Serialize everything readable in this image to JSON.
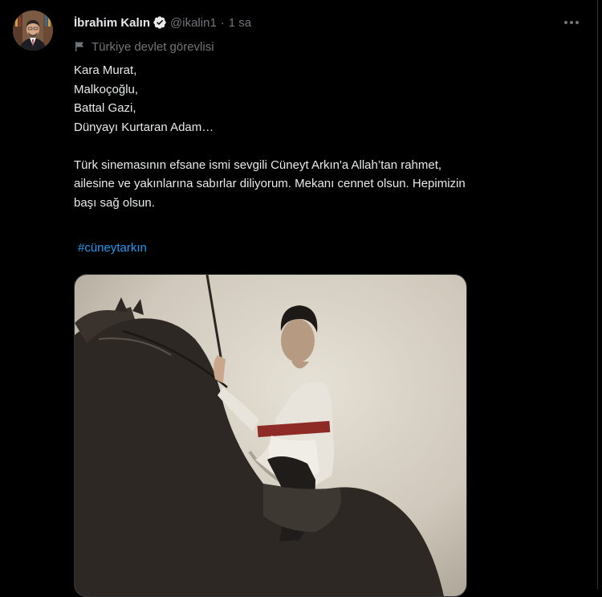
{
  "author": {
    "name": "İbrahim Kalın",
    "handle": "@ikalin1",
    "separator": "·",
    "time": "1 sa",
    "affiliation": "Türkiye devlet görevlisi"
  },
  "tweet": {
    "lines": [
      "Kara Murat,",
      "Malkoçoğlu,",
      "Battal Gazi,",
      "Dünyayı Kurtaran Adam…"
    ],
    "paragraph_lines": [
      "Türk sinemasının efsane ismi sevgili Cüneyt Arkın'a Allah’tan rahmet,",
      "ailesine ve yakınlarına sabırlar diliyorum. Mekanı cennet olsun. Hepimizin",
      "başı sağ olsun."
    ],
    "hashtag": "#cüneytarkın"
  },
  "icons": {
    "verified": "verified-badge-icon",
    "more": "more-options-icon",
    "affiliation": "flag-icon"
  },
  "colors": {
    "background": "#000000",
    "text": "#e7e9ea",
    "muted": "#71767b",
    "accent": "#1d9bf0",
    "border": "#2f3336"
  }
}
